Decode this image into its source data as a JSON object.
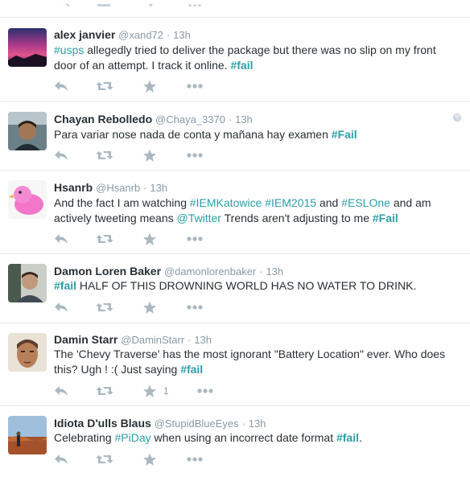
{
  "tweets": [
    {
      "name": "alex janvier",
      "handle": "@xand72",
      "time": "13h",
      "text": [
        {
          "t": "tag",
          "v": "#usps"
        },
        {
          "t": "txt",
          "v": " allegedly tried to deliver the package but there was no slip on my front door of an attempt. I track it online. "
        },
        {
          "t": "tagb",
          "v": "#fail"
        }
      ]
    },
    {
      "name": "Chayan Rebolledo",
      "handle": "@Chaya_3370",
      "time": "13h",
      "text": [
        {
          "t": "txt",
          "v": "Para variar nose nada de conta y mañana hay examen "
        },
        {
          "t": "tagb",
          "v": "#Fail"
        }
      ]
    },
    {
      "name": "Hsanrb",
      "handle": "@Hsanrb",
      "time": "13h",
      "text": [
        {
          "t": "txt",
          "v": "And the fact I am watching "
        },
        {
          "t": "tag",
          "v": "#IEMKatowice"
        },
        {
          "t": "txt",
          "v": " "
        },
        {
          "t": "tag",
          "v": "#IEM2015"
        },
        {
          "t": "txt",
          "v": " and "
        },
        {
          "t": "tag",
          "v": "#ESLOne"
        },
        {
          "t": "txt",
          "v": " and am actively tweeting means "
        },
        {
          "t": "mention",
          "v": "@Twitter"
        },
        {
          "t": "txt",
          "v": " Trends aren't adjusting to me "
        },
        {
          "t": "tagb",
          "v": "#Fail"
        }
      ]
    },
    {
      "name": "Damon Loren Baker",
      "handle": "@damonlorenbaker",
      "time": "13h",
      "text": [
        {
          "t": "tagb",
          "v": "#fail"
        },
        {
          "t": "txt",
          "v": " HALF OF THIS DROWNING WORLD HAS NO WATER TO DRINK."
        }
      ]
    },
    {
      "name": "Damin Starr",
      "handle": "@DaminStarr",
      "time": "13h",
      "text": [
        {
          "t": "txt",
          "v": "The 'Chevy Traverse' has the most ignorant \"Battery Location\" ever.  Who does this?  Ugh ! :(     Just saying "
        },
        {
          "t": "tagb",
          "v": "#fail"
        }
      ],
      "fav_count": "1"
    },
    {
      "name": "Idiota D'ulls Blaus",
      "handle": "@StupidBlueEyes",
      "time": "13h",
      "text": [
        {
          "t": "txt",
          "v": "Celebrating "
        },
        {
          "t": "tag",
          "v": "#PiDay"
        },
        {
          "t": "txt",
          "v": " when using an incorrect date format "
        },
        {
          "t": "tagb",
          "v": "#fail"
        },
        {
          "t": "txt",
          "v": "."
        }
      ]
    }
  ],
  "dot": "·",
  "colors": {
    "link": "#2b9fa6",
    "action": "#aab8c2",
    "meta": "#8899a6",
    "border": "#e1e8ed"
  }
}
